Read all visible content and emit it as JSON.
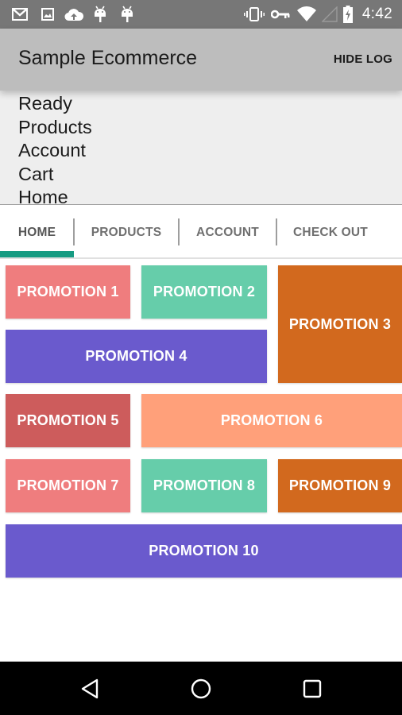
{
  "status_bar": {
    "left_icons": [
      "gmail-icon",
      "gallery-icon",
      "cloud-upload-icon",
      "android-icon",
      "android-icon"
    ],
    "right_icons": [
      "vibrate-icon",
      "vpn-key-icon",
      "wifi-icon",
      "cell-signal-icon",
      "battery-charging-icon"
    ],
    "time": "4:42"
  },
  "app_bar": {
    "title": "Sample Ecommerce",
    "action_label": "HIDE LOG",
    "background": "#bdbdbd"
  },
  "log": {
    "lines": [
      "Ready",
      "Products",
      "Account",
      "Cart",
      "Home"
    ]
  },
  "tabs": {
    "items": [
      {
        "label": "HOME",
        "selected": true
      },
      {
        "label": "PRODUCTS",
        "selected": false
      },
      {
        "label": "ACCOUNT",
        "selected": false
      },
      {
        "label": "CHECK OUT",
        "selected": false
      }
    ],
    "indicator_color": "#169b82"
  },
  "promotions": [
    {
      "label": "PROMOTION 1",
      "color": "#ef7d7e"
    },
    {
      "label": "PROMOTION 2",
      "color": "#66cdaa"
    },
    {
      "label": "PROMOTION 3",
      "color": "#d2691e"
    },
    {
      "label": "PROMOTION 4",
      "color": "#6a5acd"
    },
    {
      "label": "PROMOTION 5",
      "color": "#cd5c5c"
    },
    {
      "label": "PROMOTION 6",
      "color": "#ffa07a"
    },
    {
      "label": "PROMOTION 7",
      "color": "#ef7d7e"
    },
    {
      "label": "PROMOTION 8",
      "color": "#66cdaa"
    },
    {
      "label": "PROMOTION 9",
      "color": "#d2691e"
    },
    {
      "label": "PROMOTION 10",
      "color": "#6a5acd"
    }
  ],
  "nav_bar": {
    "buttons": [
      "back-icon",
      "home-icon",
      "recents-icon"
    ]
  }
}
